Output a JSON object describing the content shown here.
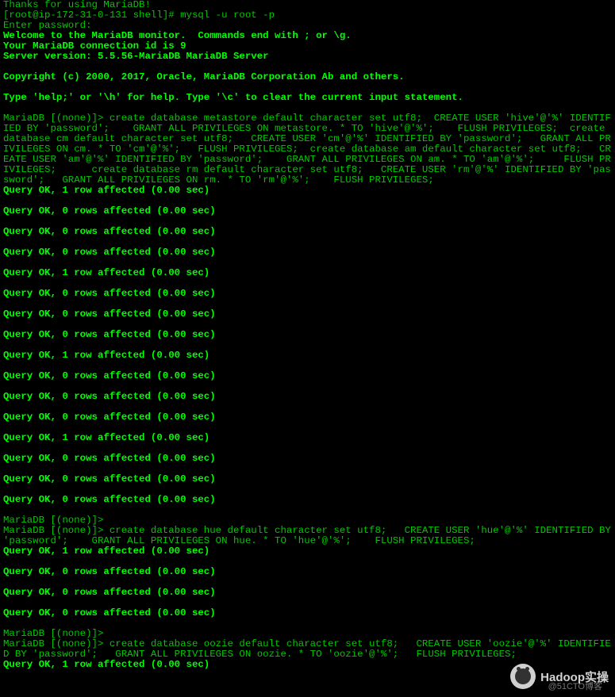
{
  "lines": [
    {
      "cls": "normal",
      "text": "Thanks for using MariaDB!"
    },
    {
      "cls": "normal",
      "text": "[root@ip-172-31-0-131 shell]# mysql -u root -p"
    },
    {
      "cls": "normal",
      "text": "Enter password:"
    },
    {
      "cls": "bold",
      "text": "Welcome to the MariaDB monitor.  Commands end with ; or \\g."
    },
    {
      "cls": "bold",
      "text": "Your MariaDB connection id is 9"
    },
    {
      "cls": "bold",
      "text": "Server version: 5.5.56-MariaDB MariaDB Server"
    },
    {
      "cls": "bold",
      "text": ""
    },
    {
      "cls": "bold",
      "text": "Copyright (c) 2000, 2017, Oracle, MariaDB Corporation Ab and others."
    },
    {
      "cls": "bold",
      "text": ""
    },
    {
      "cls": "bold",
      "text": "Type 'help;' or '\\h' for help. Type '\\c' to clear the current input statement."
    },
    {
      "cls": "normal",
      "text": ""
    },
    {
      "cls": "normal",
      "text": "MariaDB [(none)]> create database metastore default character set utf8;  CREATE USER 'hive'@'%' IDENTIFIED BY 'password';    GRANT ALL PRIVILEGES ON metastore. * TO 'hive'@'%';    FLUSH PRIVILEGES;  create database cm default character set utf8;   CREATE USER 'cm'@'%' IDENTIFIED BY 'password';   GRANT ALL PRIVILEGES ON cm. * TO 'cm'@'%';   FLUSH PRIVILEGES;  create database am default character set utf8;   CREATE USER 'am'@'%' IDENTIFIED BY 'password';    GRANT ALL PRIVILEGES ON am. * TO 'am'@'%';     FLUSH PRIVILEGES;      create database rm default character set utf8;   CREATE USER 'rm'@'%' IDENTIFIED BY 'password';   GRANT ALL PRIVILEGES ON rm. * TO 'rm'@'%';    FLUSH PRIVILEGES;"
    },
    {
      "cls": "bold",
      "text": "Query OK, 1 row affected (0.00 sec)"
    },
    {
      "cls": "bold",
      "text": ""
    },
    {
      "cls": "bold",
      "text": "Query OK, 0 rows affected (0.00 sec)"
    },
    {
      "cls": "bold",
      "text": ""
    },
    {
      "cls": "bold",
      "text": "Query OK, 0 rows affected (0.00 sec)"
    },
    {
      "cls": "bold",
      "text": ""
    },
    {
      "cls": "bold",
      "text": "Query OK, 0 rows affected (0.00 sec)"
    },
    {
      "cls": "bold",
      "text": ""
    },
    {
      "cls": "bold",
      "text": "Query OK, 1 row affected (0.00 sec)"
    },
    {
      "cls": "bold",
      "text": ""
    },
    {
      "cls": "bold",
      "text": "Query OK, 0 rows affected (0.00 sec)"
    },
    {
      "cls": "bold",
      "text": ""
    },
    {
      "cls": "bold",
      "text": "Query OK, 0 rows affected (0.00 sec)"
    },
    {
      "cls": "bold",
      "text": ""
    },
    {
      "cls": "bold",
      "text": "Query OK, 0 rows affected (0.00 sec)"
    },
    {
      "cls": "bold",
      "text": ""
    },
    {
      "cls": "bold",
      "text": "Query OK, 1 row affected (0.00 sec)"
    },
    {
      "cls": "bold",
      "text": ""
    },
    {
      "cls": "bold",
      "text": "Query OK, 0 rows affected (0.00 sec)"
    },
    {
      "cls": "bold",
      "text": ""
    },
    {
      "cls": "bold",
      "text": "Query OK, 0 rows affected (0.00 sec)"
    },
    {
      "cls": "bold",
      "text": ""
    },
    {
      "cls": "bold",
      "text": "Query OK, 0 rows affected (0.00 sec)"
    },
    {
      "cls": "bold",
      "text": ""
    },
    {
      "cls": "bold",
      "text": "Query OK, 1 row affected (0.00 sec)"
    },
    {
      "cls": "bold",
      "text": ""
    },
    {
      "cls": "bold",
      "text": "Query OK, 0 rows affected (0.00 sec)"
    },
    {
      "cls": "bold",
      "text": ""
    },
    {
      "cls": "bold",
      "text": "Query OK, 0 rows affected (0.00 sec)"
    },
    {
      "cls": "bold",
      "text": ""
    },
    {
      "cls": "bold",
      "text": "Query OK, 0 rows affected (0.00 sec)"
    },
    {
      "cls": "bold",
      "text": ""
    },
    {
      "cls": "normal",
      "text": "MariaDB [(none)]>"
    },
    {
      "cls": "normal",
      "text": "MariaDB [(none)]> create database hue default character set utf8;   CREATE USER 'hue'@'%' IDENTIFIED BY 'password';    GRANT ALL PRIVILEGES ON hue. * TO 'hue'@'%';    FLUSH PRIVILEGES;"
    },
    {
      "cls": "bold",
      "text": "Query OK, 1 row affected (0.00 sec)"
    },
    {
      "cls": "bold",
      "text": ""
    },
    {
      "cls": "bold",
      "text": "Query OK, 0 rows affected (0.00 sec)"
    },
    {
      "cls": "bold",
      "text": ""
    },
    {
      "cls": "bold",
      "text": "Query OK, 0 rows affected (0.00 sec)"
    },
    {
      "cls": "bold",
      "text": ""
    },
    {
      "cls": "bold",
      "text": "Query OK, 0 rows affected (0.00 sec)"
    },
    {
      "cls": "bold",
      "text": ""
    },
    {
      "cls": "normal",
      "text": "MariaDB [(none)]>"
    },
    {
      "cls": "normal",
      "text": "MariaDB [(none)]> create database oozie default character set utf8;   CREATE USER 'oozie'@'%' IDENTIFIED BY 'password';   GRANT ALL PRIVILEGES ON oozie. * TO 'oozie'@'%';   FLUSH PRIVILEGES;"
    },
    {
      "cls": "bold",
      "text": "Query OK, 1 row affected (0.00 sec)"
    },
    {
      "cls": "bold",
      "text": ""
    }
  ],
  "watermark": {
    "main": "Hadoop实操",
    "sub": "@51CTO博客"
  }
}
